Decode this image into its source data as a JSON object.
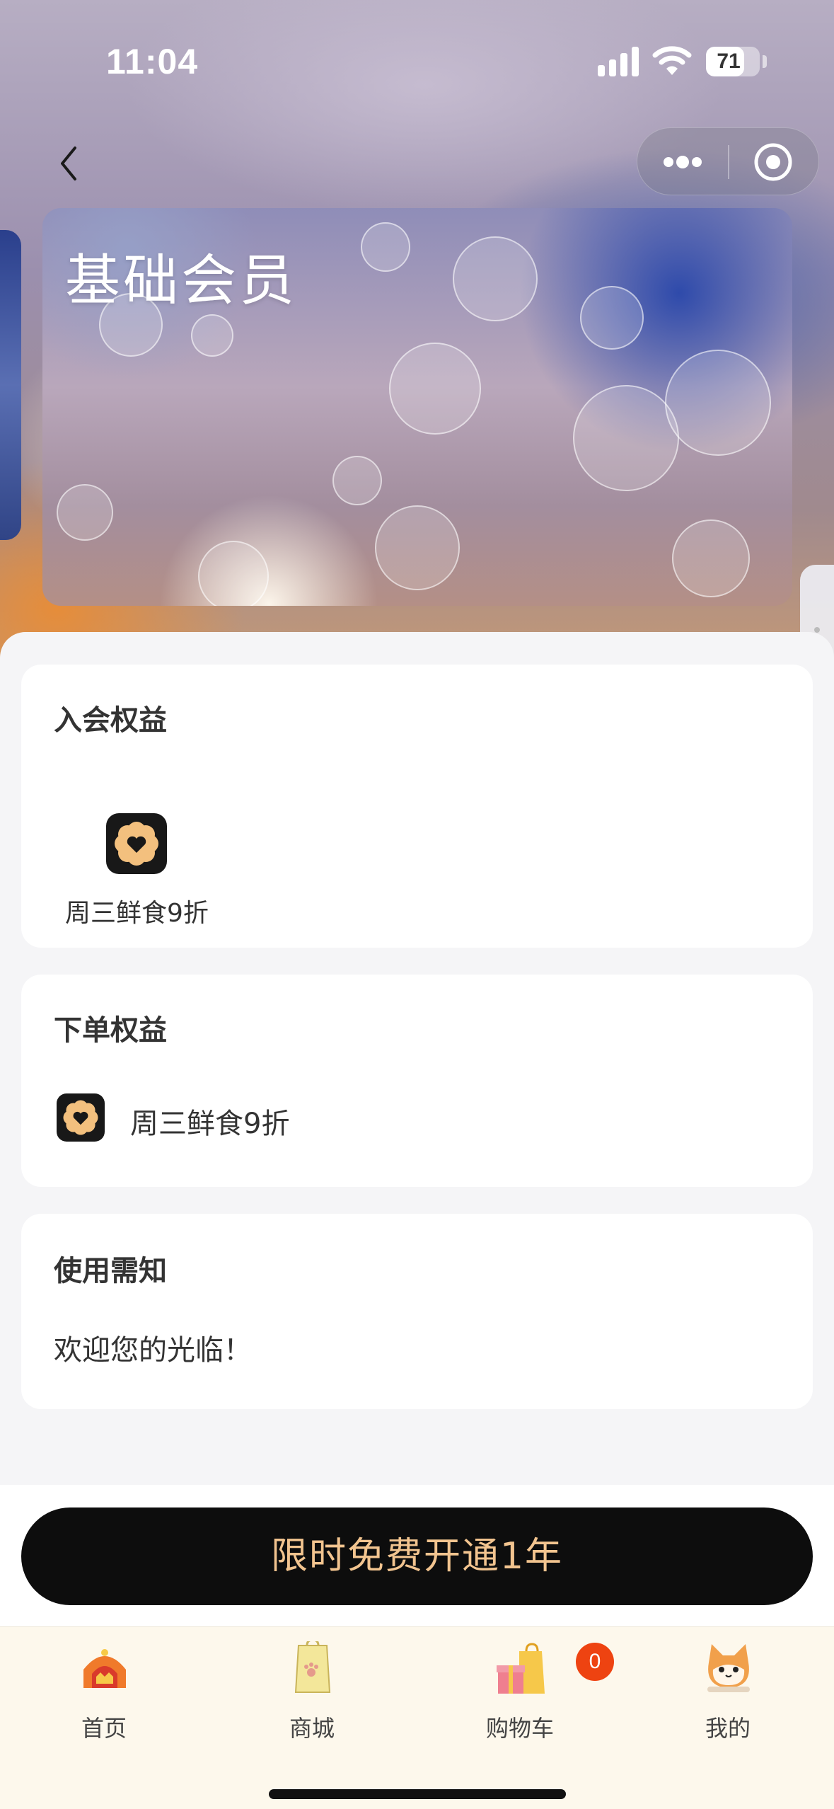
{
  "status_bar": {
    "time": "11:04",
    "battery_level": "71",
    "battery_fraction": 0.71
  },
  "nav": {
    "back_icon": "chevron-left-icon",
    "more_icon": "more-dots-icon",
    "close_icon": "target-circle-icon"
  },
  "card": {
    "title": "基础会员"
  },
  "join_benefits": {
    "title": "入会权益",
    "items": [
      {
        "label": "周三鲜食9折",
        "icon": "flower-heart-icon"
      }
    ]
  },
  "order_benefits": {
    "title": "下单权益",
    "items": [
      {
        "label": "周三鲜食9折",
        "icon": "flower-heart-icon"
      }
    ]
  },
  "notice": {
    "title": "使用需知",
    "text": "欢迎您的光临！"
  },
  "cta": {
    "label": "限时免费开通1年"
  },
  "tabbar": {
    "items": [
      {
        "label": "首页",
        "icon": "pet-house-icon"
      },
      {
        "label": "商城",
        "icon": "shopping-bag-icon"
      },
      {
        "label": "购物车",
        "icon": "gift-cart-icon"
      },
      {
        "label": "我的",
        "icon": "cat-avatar-icon"
      }
    ],
    "cart_badge": "0"
  },
  "colors": {
    "cta_background": "#0d0d0d",
    "cta_text": "#f2c48f",
    "badge": "#ee4311",
    "tabbar_background": "#fdf8ec"
  }
}
